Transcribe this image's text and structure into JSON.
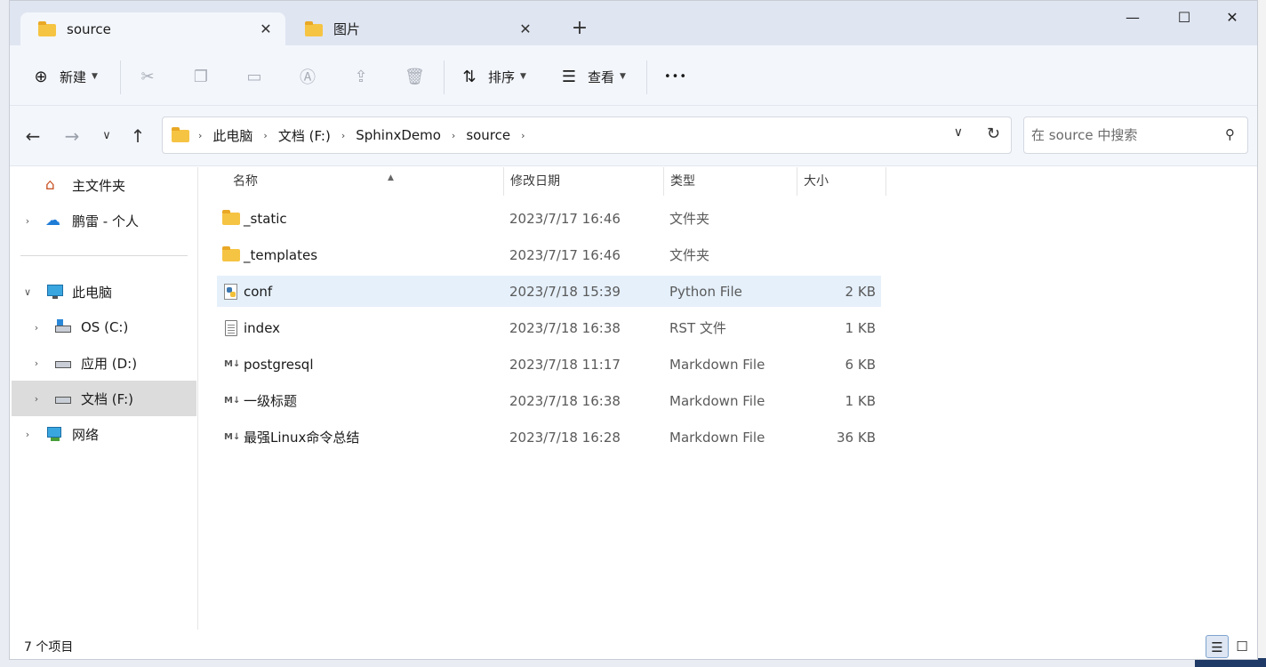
{
  "tabs": [
    {
      "label": "source",
      "active": true
    },
    {
      "label": "图片",
      "active": false
    }
  ],
  "window_controls": {
    "minimize": "—",
    "maximize": "☐",
    "close": "✕"
  },
  "toolbar": {
    "new_label": "新建",
    "sort_label": "排序",
    "view_label": "查看",
    "more_label": "•••",
    "disabled_icons": [
      "cut-icon",
      "copy-icon",
      "paste-icon",
      "rename-icon",
      "share-icon",
      "delete-icon"
    ]
  },
  "address": {
    "crumbs": [
      "此电脑",
      "文档 (F:)",
      "SphinxDemo",
      "source"
    ],
    "search_placeholder": "在 source 中搜索"
  },
  "sidebar": {
    "items": [
      {
        "label": "主文件夹",
        "icon": "home-icon",
        "expandable": false
      },
      {
        "label": "鹏雷 - 个人",
        "icon": "onedrive-cloud-icon",
        "expandable": true
      },
      {
        "label": "此电脑",
        "icon": "monitor-icon",
        "expandable": true,
        "expanded": true
      },
      {
        "label": "OS (C:)",
        "icon": "windows-drive-icon",
        "expandable": true
      },
      {
        "label": "应用 (D:)",
        "icon": "drive-icon",
        "expandable": true
      },
      {
        "label": "文档 (F:)",
        "icon": "drive-icon",
        "expandable": true,
        "selected": true
      },
      {
        "label": "网络",
        "icon": "network-icon",
        "expandable": true
      }
    ]
  },
  "columns": {
    "name": "名称",
    "modified": "修改日期",
    "type": "类型",
    "size": "大小"
  },
  "files": [
    {
      "name": "_static",
      "modified": "2023/7/17 16:46",
      "type": "文件夹",
      "size": "",
      "icon": "folder-icon"
    },
    {
      "name": "_templates",
      "modified": "2023/7/17 16:46",
      "type": "文件夹",
      "size": "",
      "icon": "folder-icon"
    },
    {
      "name": "conf",
      "modified": "2023/7/18 15:39",
      "type": "Python File",
      "size": "2 KB",
      "icon": "python-file-icon",
      "highlighted": true
    },
    {
      "name": "index",
      "modified": "2023/7/18 16:38",
      "type": "RST 文件",
      "size": "1 KB",
      "icon": "text-file-icon"
    },
    {
      "name": "postgresql",
      "modified": "2023/7/18 11:17",
      "type": "Markdown File",
      "size": "6 KB",
      "icon": "markdown-file-icon"
    },
    {
      "name": "一级标题",
      "modified": "2023/7/18 16:38",
      "type": "Markdown File",
      "size": "1 KB",
      "icon": "markdown-file-icon"
    },
    {
      "name": "最强Linux命令总结",
      "modified": "2023/7/18 16:28",
      "type": "Markdown File",
      "size": "36 KB",
      "icon": "markdown-file-icon"
    }
  ],
  "status": {
    "item_count": "7 个项目"
  },
  "colors": {
    "accent": "#0067c0",
    "selection": "#e5f0fb",
    "titlebar": "#dfe5f1",
    "folder": "#f6c443"
  }
}
